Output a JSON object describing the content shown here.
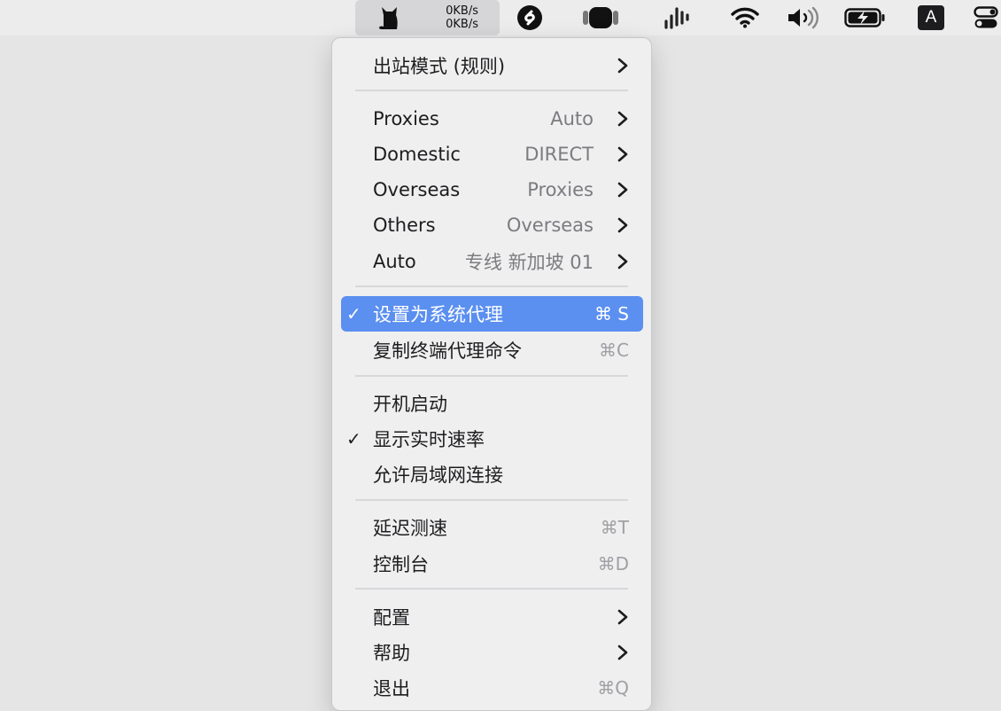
{
  "menubar": {
    "upload_speed": "0KB/s",
    "download_speed": "0KB/s",
    "icons": [
      "cat-icon",
      "shazam-icon",
      "dynamic-island-icon",
      "audio-waveform-icon",
      "wifi-icon",
      "volume-icon",
      "battery-charging-icon",
      "input-source-icon",
      "control-center-icon"
    ],
    "input_source_letter": "A"
  },
  "menu": {
    "outbound_mode": {
      "label": "出站模式 (规则)"
    },
    "proxy_groups": [
      {
        "label": "Proxies",
        "value": "Auto"
      },
      {
        "label": "Domestic",
        "value": "DIRECT"
      },
      {
        "label": "Overseas",
        "value": "Proxies"
      },
      {
        "label": "Others",
        "value": "Overseas"
      },
      {
        "label": "Auto",
        "value": "专线 新加坡 01"
      }
    ],
    "set_system_proxy": {
      "label": "设置为系统代理",
      "shortcut": "⌘ S",
      "checked": true
    },
    "copy_terminal_command": {
      "label": "复制终端代理命令",
      "shortcut": "⌘C"
    },
    "launch_at_login": {
      "label": "开机启动"
    },
    "show_speed": {
      "label": "显示实时速率",
      "checked": true
    },
    "allow_lan": {
      "label": "允许局域网连接"
    },
    "latency_test": {
      "label": "延迟测速",
      "shortcut": "⌘T"
    },
    "dashboard": {
      "label": "控制台",
      "shortcut": "⌘D"
    },
    "config": {
      "label": "配置"
    },
    "help": {
      "label": "帮助"
    },
    "quit": {
      "label": "退出",
      "shortcut": "⌘Q"
    },
    "check_glyph": "✓"
  },
  "colors": {
    "highlight": "#5b8ff0",
    "menu_bg": "#efeff0",
    "secondary_text": "#7c7c80",
    "shortcut_text": "#a0a0a4"
  }
}
